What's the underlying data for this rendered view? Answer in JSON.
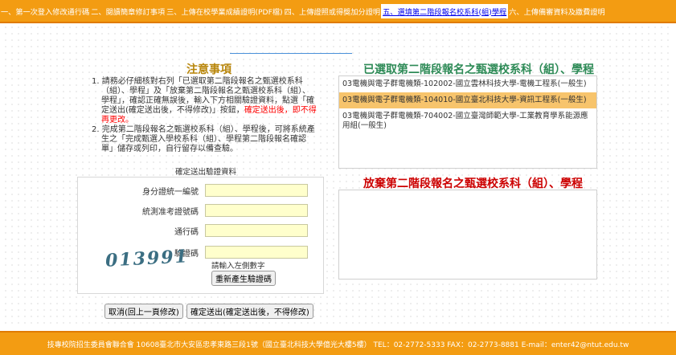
{
  "steps": [
    {
      "label": "一、第一次登入修改通行碼",
      "active": false
    },
    {
      "label": "二、閱讀簡章修訂事項",
      "active": false
    },
    {
      "label": "三、上傳在校學業成績證明(PDF檔)",
      "active": false
    },
    {
      "label": "四、上傳證照或得獎加分證明",
      "active": false
    },
    {
      "label": "五、選填第二階段報名校系科(組)學程",
      "active": true
    },
    {
      "label": "六、上傳備審資料及繳費證明",
      "active": false
    }
  ],
  "notice": {
    "title": "注意事項",
    "item1_a": "1. 請務必仔細核對右列「已選取第二階段報名之甄選校系科（組）、學程」及「放棄第二階段報名之甄選校系科（組）、學程」，確認正確無誤後，輸入下方相關驗證資料，點選「確定送出(確定送出後，不得修改)」按鈕，",
    "item1_red": "確定送出後，即不得再更改。",
    "item2": "2. 完成第二階段報名之甄選校系科（組）、學程後，可將系統產生之「完成甄選入學校系科（組）、學程第二階段報名確認單」儲存或列印，自行留存以備查驗。"
  },
  "confirm": {
    "title": "確定送出驗證資料",
    "id_label": "身分證統一編號",
    "exam_label": "統測准考證號碼",
    "pass_label": "通行碼",
    "captcha_label": "驗證碼",
    "captcha_code": "013991",
    "captcha_hint": "請輸入左側數字",
    "regen_button": "重新產生驗證碼",
    "id_value": "",
    "exam_value": "",
    "pass_value": "",
    "captcha_value": ""
  },
  "buttons": {
    "cancel": "取消(回上一頁修改)",
    "submit": "確定送出(確定送出後，不得修改)"
  },
  "selected": {
    "title": "已選取第二階段報名之甄選校系科（組）、學程",
    "items": [
      {
        "text": "03電機與電子群電機類-102002-國立雲林科技大學-電機工程系(一般生)",
        "highlight": false
      },
      {
        "text": "03電機與電子群電機類-104010-國立臺北科技大學-資訊工程系(一般生)",
        "highlight": true
      },
      {
        "text": "03電機與電子群電機類-704002-國立臺灣師範大學-工業教育學系能源應用組(一般生)",
        "highlight": false
      }
    ]
  },
  "dropped": {
    "title": "放棄第二階段報名之甄選校系科（組）、學程",
    "items": []
  },
  "footer": "技專校院招生委員會聯合會 10608臺北市大安區忠孝東路三段1號（國立臺北科技大學億光大樓5樓） TEL：02-2772-5333 FAX：02-2773-8881 E-mail：enter42@ntut.edu.tw"
}
